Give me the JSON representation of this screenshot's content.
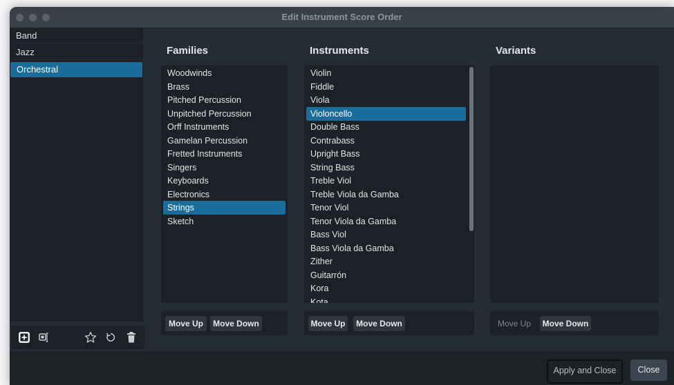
{
  "window": {
    "title": "Edit Instrument Score Order"
  },
  "sidebar": {
    "items": [
      {
        "label": "Band",
        "selected": false
      },
      {
        "label": "Jazz",
        "selected": false
      },
      {
        "label": "Orchestral",
        "selected": true
      }
    ],
    "toolbar_icons": [
      "add-icon",
      "rename-icon",
      "star-icon",
      "reset-icon",
      "trash-icon"
    ]
  },
  "families": {
    "title": "Families",
    "items": [
      "Woodwinds",
      "Brass",
      "Pitched Percussion",
      "Unpitched Percussion",
      "Orff Instruments",
      "Gamelan Percussion",
      "Fretted Instruments",
      "Singers",
      "Keyboards",
      "Electronics",
      "Strings",
      "Sketch"
    ],
    "selected": "Strings",
    "move_up": "Move Up",
    "move_down": "Move Down"
  },
  "instruments": {
    "title": "Instruments",
    "items": [
      "Violin",
      "Fiddle",
      "Viola",
      "Violoncello",
      "Double Bass",
      "Contrabass",
      "Upright Bass",
      "String Bass",
      "Treble Viol",
      "Treble Viola da Gamba",
      "Tenor Viol",
      "Tenor Viola da Gamba",
      "Bass Viol",
      "Bass Viola da Gamba",
      "Zither",
      "Guitarrón",
      "Kora",
      "Kota"
    ],
    "selected": "Violoncello",
    "move_up": "Move Up",
    "move_down": "Move Down"
  },
  "variants": {
    "title": "Variants",
    "items": [],
    "move_up": "Move Up",
    "move_down": "Move Down"
  },
  "footer": {
    "apply_label": "Apply and Close",
    "close_label": "Close"
  }
}
